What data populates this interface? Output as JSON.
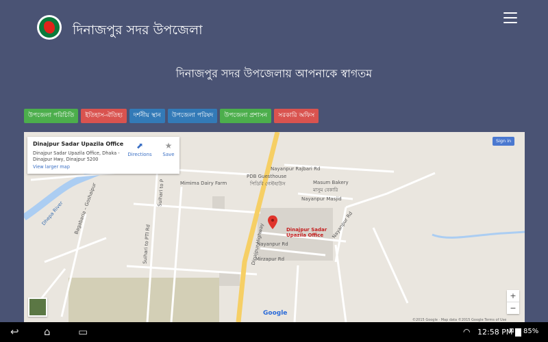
{
  "header": {
    "site_title": "দিনাজপুর সদর উপজেলা",
    "logo_icon": "bangladesh-emblem-icon",
    "menu_icon": "hamburger-menu-icon"
  },
  "welcome": "দিনাজপুর সদর উপজেলায় আপনাকে স্বাগতম",
  "nav": {
    "items": [
      {
        "label": "উপজেলা পরিচিতি",
        "color": "#4cae4c"
      },
      {
        "label": "ইতিহাস-ঐতিহ্য",
        "color": "#d9534f"
      },
      {
        "label": "দর্শনীয় স্থান",
        "color": "#337ab7"
      },
      {
        "label": "উপজেলা পরিষদ",
        "color": "#337ab7"
      },
      {
        "label": "উপজেলা প্রশাসন",
        "color": "#4cae4c"
      },
      {
        "label": "সরকারি অফিস",
        "color": "#d9534f"
      }
    ]
  },
  "map": {
    "info_title": "Dinajpur Sadar Upazila Office",
    "info_address": "Dinajpur Sadar Upazila Office, Dhaka - Dinajpur Hwy, Dinajpur 5200",
    "view_larger": "View larger map",
    "directions": "Directions",
    "save": "Save",
    "sign_in": "Sign in",
    "marker_label": "Dinajpur Sadar Upazila Office",
    "zoom_in": "+",
    "zoom_out": "−",
    "google": "Google",
    "copyright": "©2015 Google · Map data ©2015 Google  Terms of Use",
    "labels": {
      "nayanpur_rajbari": "Nayanpur Rajbari Rd",
      "pdb_guesthouse": "PDB Guesthouse",
      "pdb_bn": "পিডিবি গেস্টহাউস",
      "masum_bakery": "Masum Bakery",
      "masum_bn": "মাসুম বেকারি",
      "nayanpur_masjid": "Nayanpur Masjid",
      "mimima": "Mimima Dairy Farm",
      "nayanpur_rd": "Nayanpur Rd",
      "nayanpur_rd2": "Nayanpur Rd",
      "mirzapur": "Mirzapur Rd",
      "suihari_pti": "Suihari to PTI Rd",
      "suihan_p": "Suihari to P",
      "dhepa": "Dhepa River",
      "bagabaria": "Bagabaria – Goshaipur",
      "dinajpur_highway": "Dinajpur Highway"
    }
  },
  "status_bar": {
    "time": "12:58",
    "time_suffix": "PM",
    "battery": "85%",
    "back_icon": "back-icon",
    "home_icon": "home-icon",
    "recents_icon": "recents-icon"
  }
}
